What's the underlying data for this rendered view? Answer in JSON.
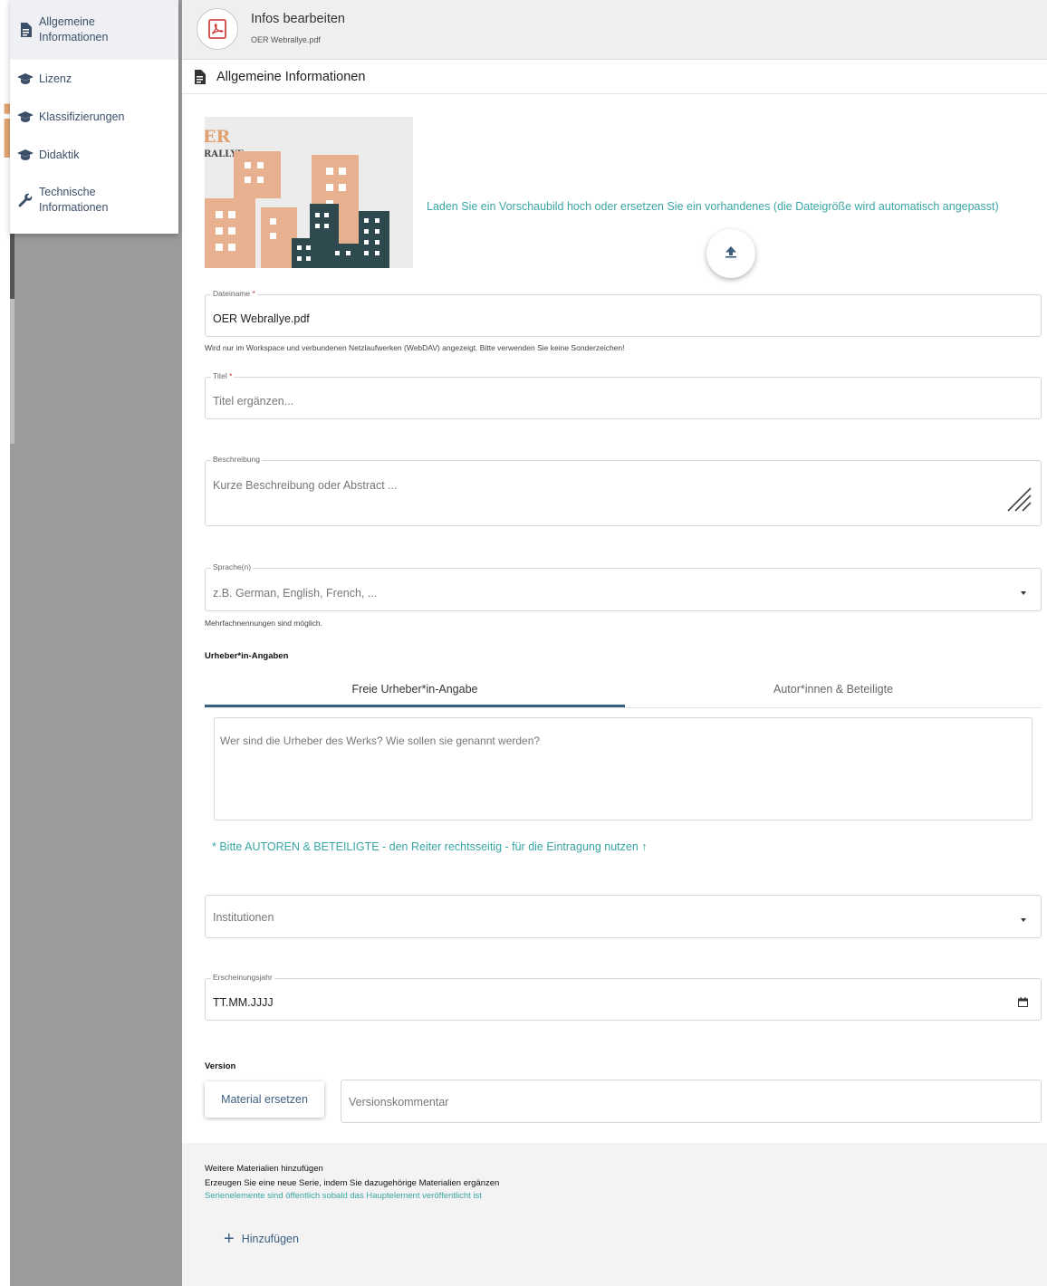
{
  "nav": {
    "items": [
      {
        "label": "Allgemeine Informationen",
        "icon": "document-icon",
        "active": true
      },
      {
        "label": "Lizenz",
        "icon": "graduation-cap-icon"
      },
      {
        "label": "Klassifizierungen",
        "icon": "graduation-cap-icon"
      },
      {
        "label": "Didaktik",
        "icon": "graduation-cap-icon"
      },
      {
        "label": "Technische Informationen",
        "icon": "wrench-icon"
      }
    ]
  },
  "header": {
    "title": "Infos bearbeiten",
    "subtitle": "OER Webrallye.pdf",
    "icon": "pdf-icon"
  },
  "section": {
    "title": "Allgemeine Informationen",
    "icon": "document-icon"
  },
  "preview": {
    "logo_line1": "ER",
    "logo_line2": "RALLYE",
    "upload_text": "Laden Sie ein Vorschaubild hoch oder ersetzen Sie ein vorhandenes (die Dateigröße wird automatisch angepasst)",
    "upload_icon": "upload-icon"
  },
  "form": {
    "filename": {
      "label": "Dateiname",
      "required_mark": "*",
      "value": "OER Webrallye.pdf",
      "hint": "Wird nur im Workspace und verbundenen Netzlaufwerken (WebDAV) angezeigt. Bitte verwenden Sie keine Sonderzeichen!"
    },
    "title": {
      "label": "Titel",
      "required_mark": "*",
      "placeholder": "Titel ergänzen..."
    },
    "description": {
      "label": "Beschreibung",
      "placeholder": "Kurze Beschreibung oder Abstract ..."
    },
    "language": {
      "label": "Sprache(n)",
      "placeholder": "z.B. German, English, French, ...",
      "hint": "Mehrfachnennungen sind möglich."
    },
    "authors": {
      "heading": "Urheber*in-Angaben",
      "tabs": [
        "Freie Urheber*in-Angabe",
        "Autor*innen & Beteiligte"
      ],
      "placeholder": "Wer sind die Urheber des Werks? Wie sollen sie genannt werden?",
      "note": "* Bitte AUTOREN & BETEILIGTE - den Reiter rechtsseitig - für die Eintragung nutzen ↑"
    },
    "institutions": {
      "placeholder": "Institutionen"
    },
    "year": {
      "label": "Erscheinungsjahr",
      "value": "TT.MM.JJJJ",
      "icon": "calendar-icon"
    },
    "version": {
      "heading": "Version",
      "button": "Material ersetzen",
      "placeholder": "Versionskommentar"
    }
  },
  "more_materials": {
    "title": "Weitere Materialien hinzufügen",
    "text": "Erzeugen Sie eine neue Serie, indem Sie dazugehörige Materialien ergänzen",
    "note": "Serienelemente sind öffentlich sobald das Hauptelement veröffentlicht ist",
    "add_button": "Hinzufügen"
  },
  "colors": {
    "accent": "#3c5f80",
    "teal": "#3aa5a5",
    "building_orange": "#e7b08f",
    "building_dark": "#2f4a4f"
  }
}
